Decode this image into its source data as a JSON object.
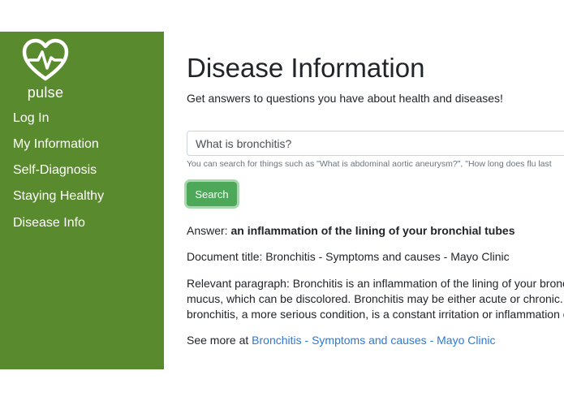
{
  "sidebar": {
    "logo_text": "pulse",
    "items": [
      {
        "label": "Log In"
      },
      {
        "label": "My Information"
      },
      {
        "label": "Self-Diagnosis"
      },
      {
        "label": "Staying Healthy"
      },
      {
        "label": "Disease Info"
      }
    ]
  },
  "main": {
    "title": "Disease Information",
    "subtitle": "Get answers to questions you have about health and diseases!",
    "search": {
      "value": "What is bronchitis?",
      "hint": "You can search for things such as \"What is abdominal aortic aneurysm?\", \"How long does flu last",
      "button_label": "Search"
    },
    "answer": {
      "label": "Answer: ",
      "text": "an inflammation of the lining of your bronchial tubes"
    },
    "document_title": "Document title: Bronchitis - Symptoms and causes - Mayo Clinic",
    "relevant_paragraph": {
      "line1": "Relevant paragraph: Bronchitis is an inflammation of the lining of your bronchial",
      "line2": "mucus, which can be discolored. Bronchitis may be either acute or chronic. Ofte",
      "line3": "bronchitis, a more serious condition, is a constant irritation or inflammation of th"
    },
    "see_more": {
      "label": "See more at ",
      "link_text": "Bronchitis - Symptoms and causes - Mayo Clinic"
    }
  },
  "colors": {
    "sidebar_bg": "#5a8a2e",
    "button_bg": "#4ea85a",
    "link": "#2a7ad6"
  }
}
